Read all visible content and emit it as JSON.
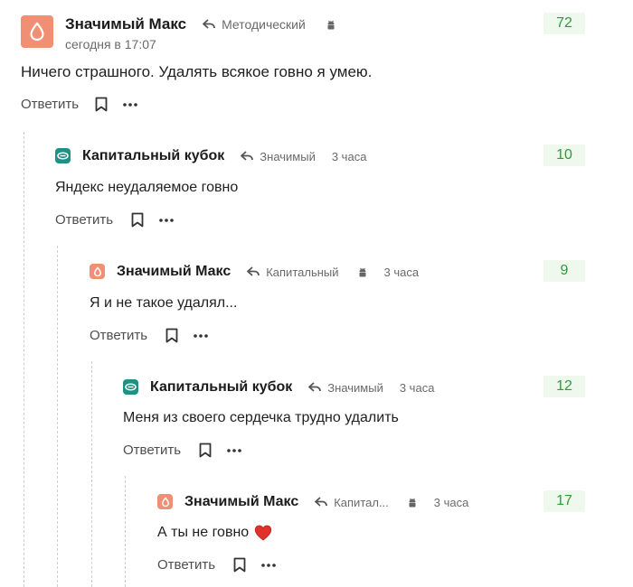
{
  "comments": [
    {
      "author": "Значимый Макс",
      "avatar_color": "#f08f74",
      "reply_to": "Методический",
      "device_icon": "android-icon",
      "time": "сегодня в 17:07",
      "text": "Ничего страшного. Удалять всякое говно я умею.",
      "score": "72",
      "reply_label": "Ответить"
    },
    {
      "author": "Капитальный кубок",
      "avatar_color": "#1f9184",
      "reply_to": "Значимый",
      "time": "3 часа",
      "text": "Яндекс неудаляемое говно",
      "score": "10",
      "reply_label": "Ответить"
    },
    {
      "author": "Значимый Макс",
      "avatar_color": "#f08f74",
      "reply_to": "Капитальный",
      "device_icon": "android-icon",
      "time": "3 часа",
      "text": "Я и не такое удалял...",
      "score": "9",
      "reply_label": "Ответить"
    },
    {
      "author": "Капитальный кубок",
      "avatar_color": "#1f9184",
      "reply_to": "Значимый",
      "time": "3 часа",
      "text": "Меня из своего сердечка трудно удалить",
      "score": "12",
      "reply_label": "Ответить"
    },
    {
      "author": "Значимый Макс",
      "avatar_color": "#f08f74",
      "reply_to": "Капитал...",
      "device_icon": "android-icon",
      "time": "3 часа",
      "text": "А ты не говно",
      "emoji": "heart-icon",
      "score": "17",
      "reply_label": "Ответить"
    }
  ],
  "colors": {
    "score_bg": "#eef8ec",
    "score_text": "#2f9a3c",
    "heart": "#e0312a"
  }
}
